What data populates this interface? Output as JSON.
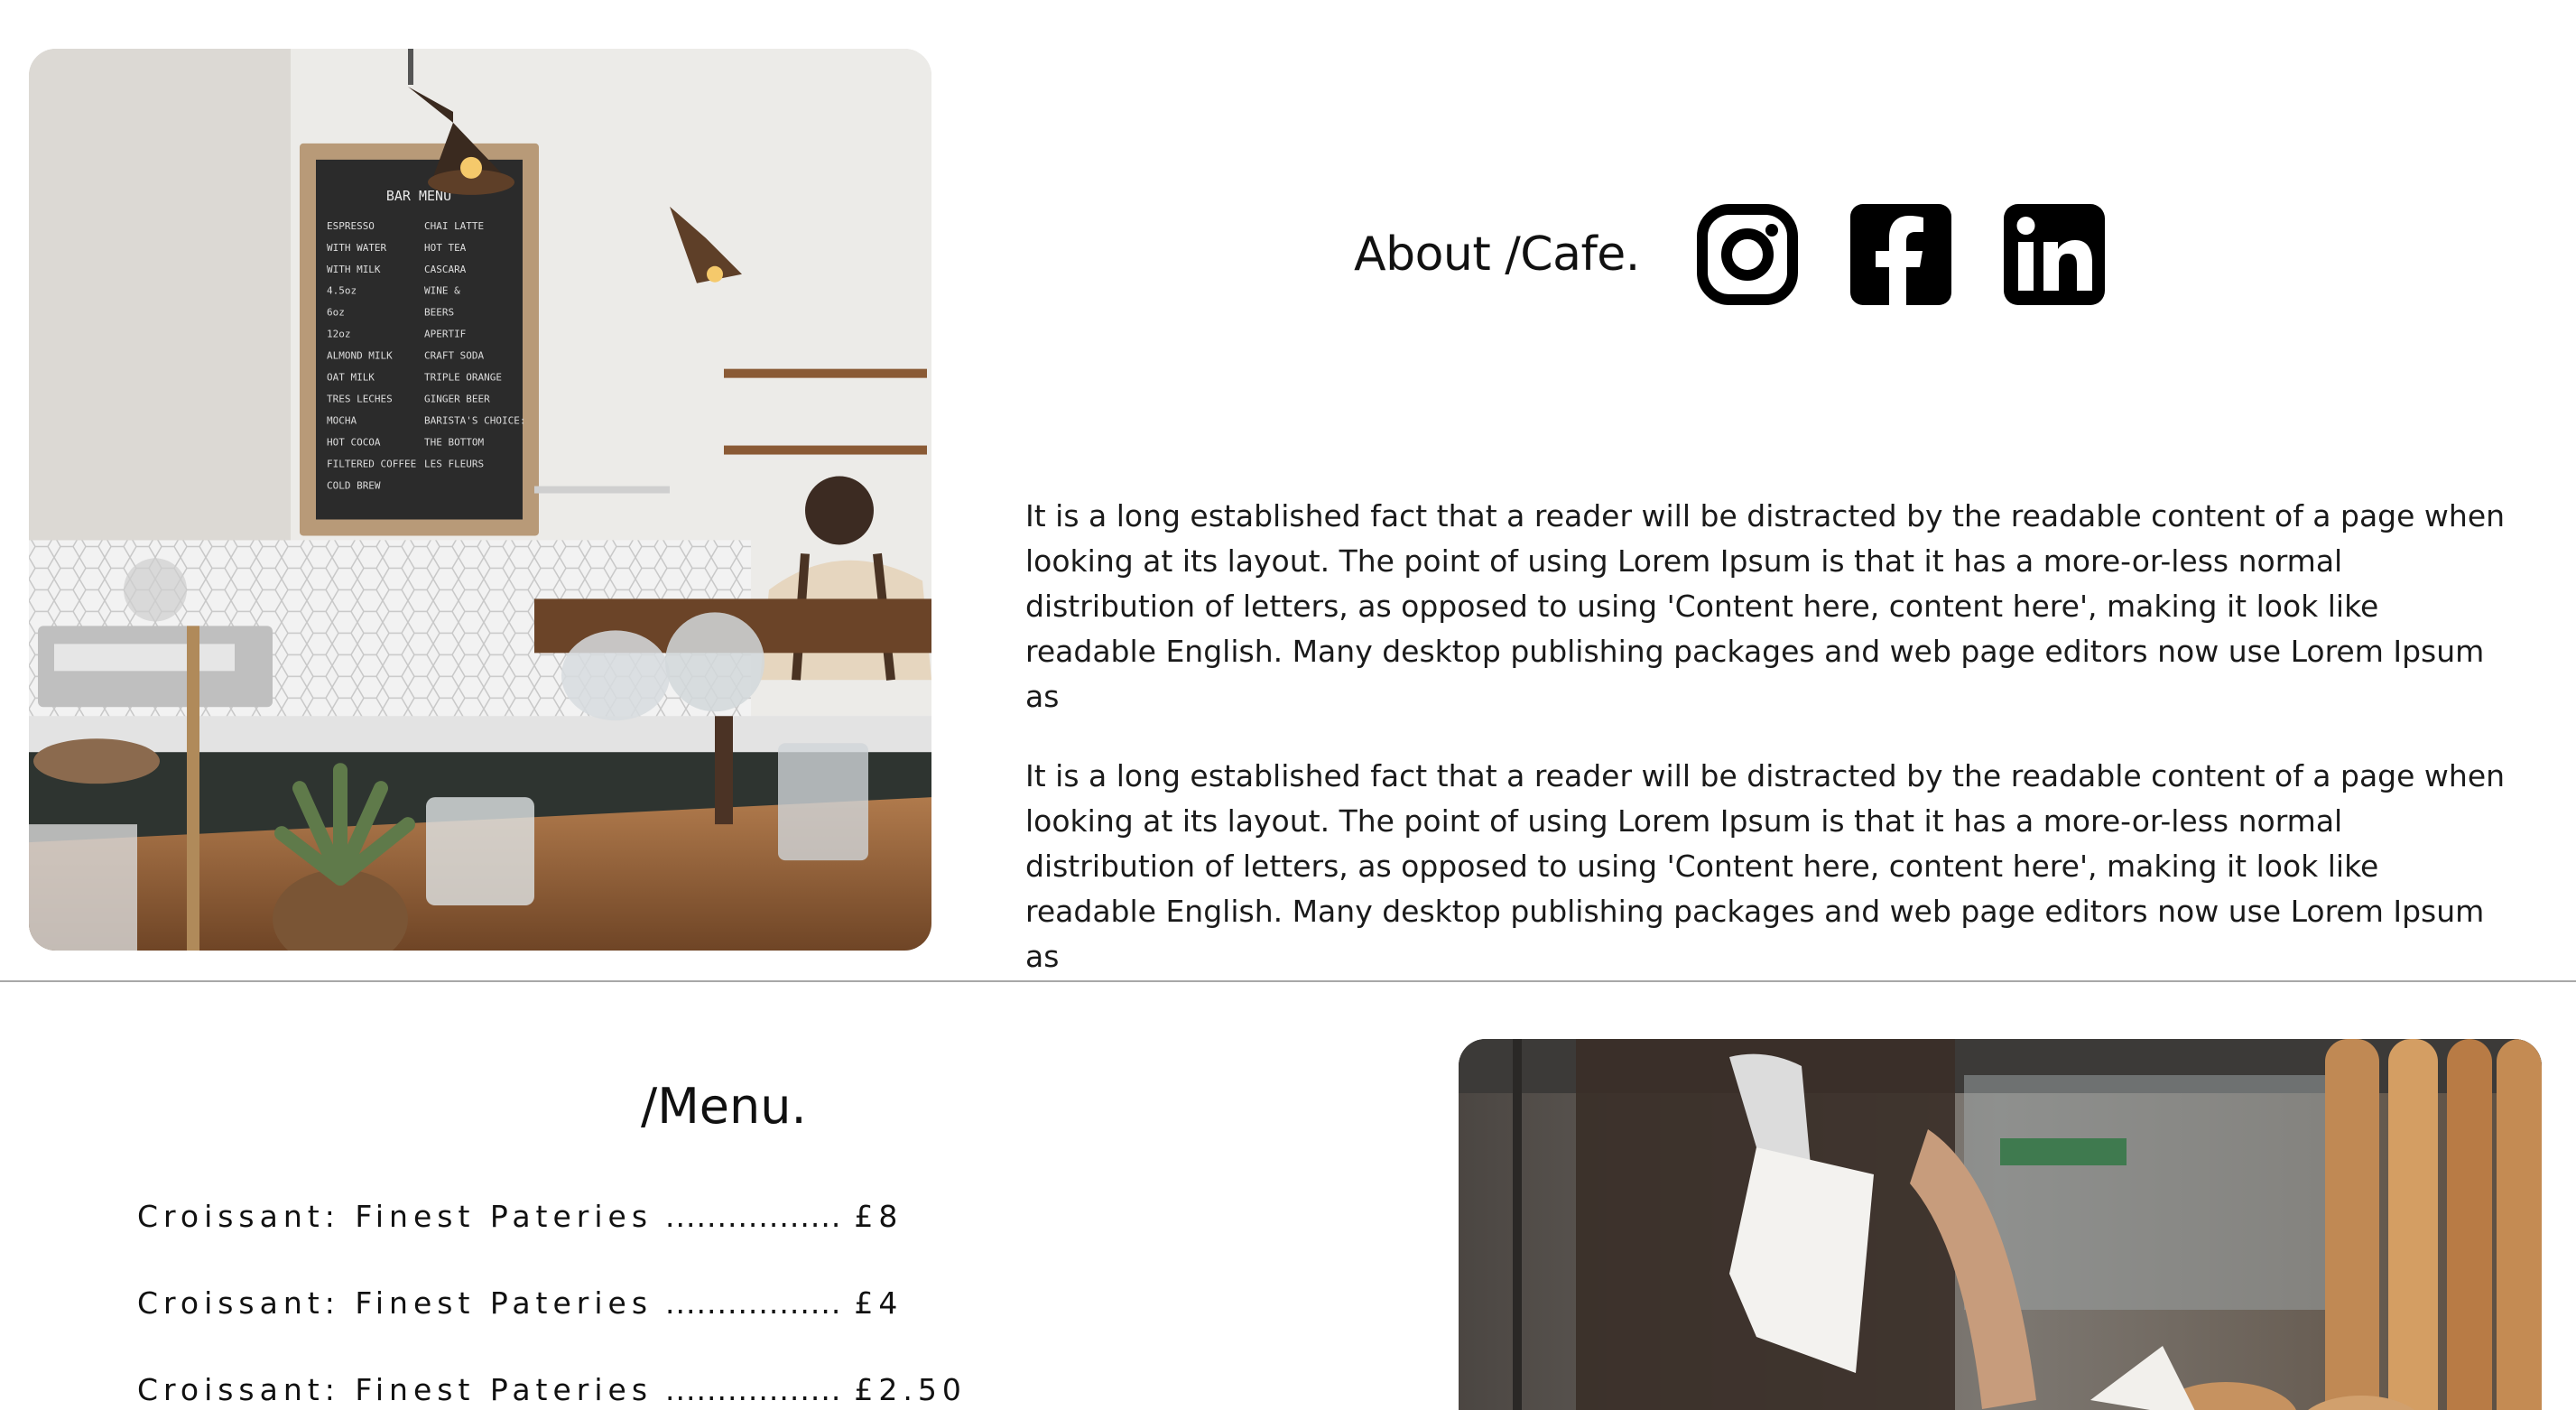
{
  "about": {
    "title": "About /Cafe.",
    "social": [
      {
        "name": "instagram-icon"
      },
      {
        "name": "facebook-icon"
      },
      {
        "name": "linkedin-icon"
      }
    ],
    "paragraphs": [
      "It is a long established fact that a reader will be distracted by the readable content of a page when looking at its layout. The point of using Lorem Ipsum is that it has a more-or-less normal distribution of letters, as opposed to using 'Content here, content here', making it look like readable English. Many desktop publishing packages and web page editors now use Lorem Ipsum as",
      "It is a long established fact that a reader will be distracted by the readable content of a page when looking at its layout. The point of using Lorem Ipsum is that it has a more-or-less normal distribution of letters, as opposed to using 'Content here, content here', making it look like readable English. Many desktop publishing packages and web page editors now use Lorem Ipsum as"
    ]
  },
  "cafe_board": {
    "heading": "BAR MENU",
    "left": [
      "ESPRESSO",
      "WITH WATER",
      "WITH MILK",
      "4.5oz",
      "6oz",
      "12oz",
      "ALMOND MILK",
      "OAT MILK",
      "TRES LECHES",
      "MOCHA",
      "HOT COCOA",
      "FILTERED COFFEE",
      "COLD BREW"
    ],
    "right": [
      "CHAI LATTE",
      "HOT TEA",
      "CASCARA",
      "WINE &",
      "BEERS",
      "APERTIF",
      "CRAFT SODA",
      "TRIPLE ORANGE",
      "GINGER BEER",
      "BARISTA'S CHOICE:",
      "THE BOTTOM",
      "LES FLEURS"
    ]
  },
  "menu": {
    "title": "/Menu.",
    "items": [
      {
        "name": "Croissant: Finest Pateries",
        "dots": ".................",
        "price": "£8"
      },
      {
        "name": "Croissant: Finest Pateries",
        "dots": ".................",
        "price": "£4"
      },
      {
        "name": "Croissant: Finest Pateries",
        "dots": ".................",
        "price": "£2.50"
      }
    ]
  },
  "colors": {
    "text": "#111111",
    "divider": "#a8a8a8",
    "board": "#2b2b2b",
    "board_frame": "#b89a78",
    "wood": "#8a5a35"
  }
}
